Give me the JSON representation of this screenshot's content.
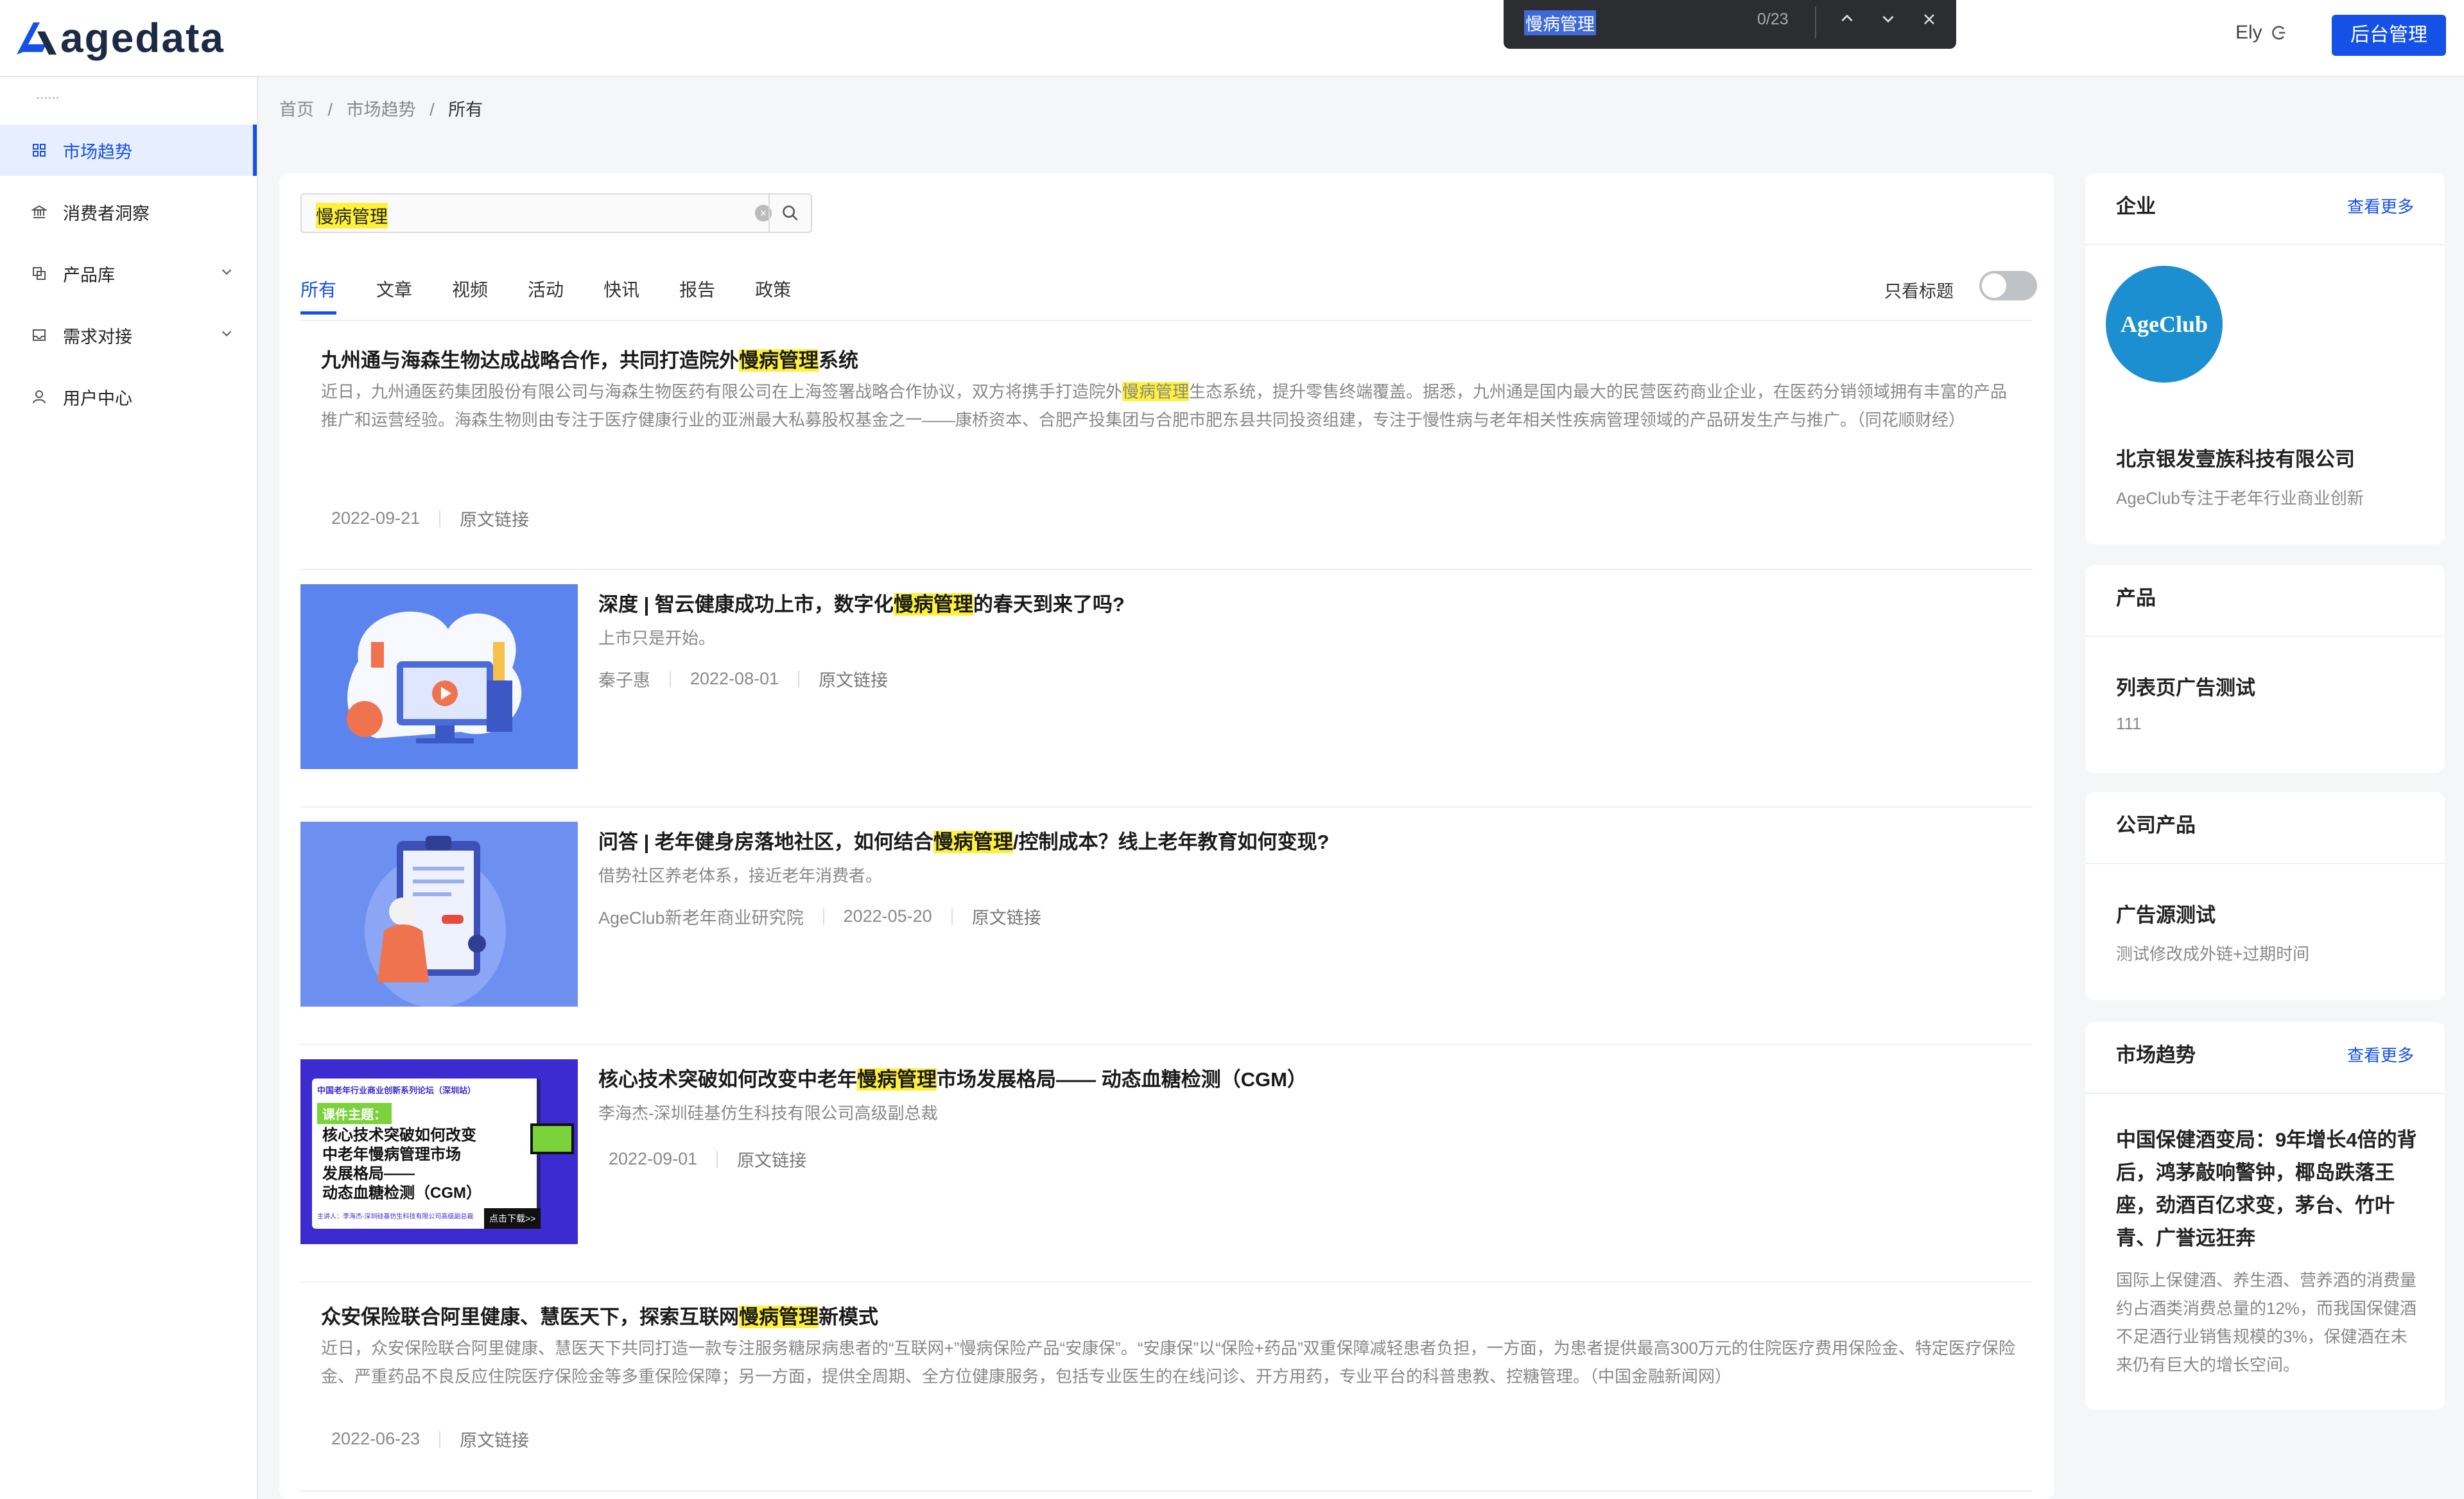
{
  "brand": {
    "logo_text": "agedata"
  },
  "find_bar": {
    "query": "慢病管理",
    "count": "0/23"
  },
  "header": {
    "user": "Ely",
    "admin_button": "后台管理"
  },
  "sidebar": {
    "dots": "......",
    "items": [
      {
        "label": "市场趋势",
        "icon": "grid-icon"
      },
      {
        "label": "消费者洞察",
        "icon": "bank-icon"
      },
      {
        "label": "产品库",
        "icon": "copy-icon"
      },
      {
        "label": "需求对接",
        "icon": "inbox-icon"
      },
      {
        "label": "用户中心",
        "icon": "user-icon"
      }
    ]
  },
  "breadcrumb": {
    "home": "首页",
    "sep": "/",
    "section": "市场趋势",
    "current": "所有"
  },
  "search": {
    "value": "慢病管理"
  },
  "tabs": [
    "所有",
    "文章",
    "视频",
    "活动",
    "快讯",
    "报告",
    "政策"
  ],
  "title_only_label": "只看标题",
  "articles": [
    {
      "title_pre": "九州通与海森生物达成战略合作，共同打造院外",
      "title_hl": "慢病管理",
      "title_post": "系统",
      "desc_pre": "近日，九州通医药集团股份有限公司与海森生物医药有限公司在上海签署战略合作协议，双方将携手打造院外",
      "desc_hl": "慢病管理",
      "desc_post": "生态系统，提升零售终端覆盖。据悉，九州通是国内最大的民营医药商业企业，在医药分销领域拥有丰富的产品推广和运营经验。海森生物则由专注于医疗健康行业的亚洲最大私募股权基金之一——康桥资本、合肥产投集团与合肥市肥东县共同投资组建，专注于慢性病与老年相关性疾病管理领域的产品研发生产与推广。（同花顺财经）",
      "date": "2022-09-21",
      "link": "原文链接"
    },
    {
      "title_pre": "深度 | 智云健康成功上市，数字化",
      "title_hl": "慢病管理",
      "title_post": "的春天到来了吗?",
      "desc": "上市只是开始。",
      "author": "秦子惠",
      "date": "2022-08-01",
      "link": "原文链接"
    },
    {
      "title_pre": "问答 | 老年健身房落地社区，如何结合",
      "title_hl": "慢病管理",
      "title_post": "/控制成本？线上老年教育如何变现?",
      "desc": "借势社区养老体系，接近老年消费者。",
      "author": "AgeClub新老年商业研究院",
      "date": "2022-05-20",
      "link": "原文链接"
    },
    {
      "title_pre": "核心技术突破如何改变中老年",
      "title_hl": "慢病管理",
      "title_post": "市场发展格局—— 动态血糖检测（CGM）",
      "desc": "李海杰-深圳硅基仿生科技有限公司高级副总裁",
      "date": "2022-09-01",
      "link": "原文链接",
      "thumb": {
        "top": "中国老年行业商业创新系列论坛（深圳站）",
        "tag": "课件主题：",
        "lines": [
          "核心技术突破如何改变",
          "中老年慢病管理市场",
          "发展格局——",
          "动态血糖检测（CGM）"
        ],
        "speaker": "主讲人：李海杰-深圳硅基仿生科技有限公司高级副总裁",
        "cta": "点击下载>>"
      }
    },
    {
      "title_pre": "众安保险联合阿里健康、慧医天下，探索互联网",
      "title_hl": "慢病管理",
      "title_post": "新模式",
      "desc": "近日，众安保险联合阿里健康、慧医天下共同打造一款专注服务糖尿病患者的“互联网+”慢病保险产品“安康保”。“安康保”以“保险+药品”双重保障减轻患者负担，一方面，为患者提供最高300万元的住院医疗费用保险金、特定医疗保险金、严重药品不良反应住院医疗保险金等多重保险保障；另一方面，提供全周期、全方位健康服务，包括专业医生的在线问诊、开方用药，专业平台的科普患教、控糖管理。（中国金融新闻网）",
      "date": "2022-06-23",
      "link": "原文链接"
    }
  ],
  "right": {
    "company": {
      "header": "企业",
      "more": "查看更多",
      "logo_text": "AgeClub",
      "name": "北京银发壹族科技有限公司",
      "desc": "AgeClub专注于老年行业商业创新"
    },
    "product": {
      "header": "产品",
      "name": "列表页广告测试",
      "desc": "111"
    },
    "company_product": {
      "header": "公司产品",
      "name": "广告源测试",
      "desc": "测试修改成外链+过期时间"
    },
    "trend": {
      "header": "市场趋势",
      "more": "查看更多",
      "title": "中国保健酒变局：9年增长4倍的背后，鸿茅敲响警钟，椰岛跌落王座，劲酒百亿求变，茅台、竹叶青、广誉远狂奔",
      "desc": "国际上保健酒、养生酒、营养酒的消费量约占酒类消费总量的12%，而我国保健酒不足酒行业销售规模的3%，保健酒在未来仍有巨大的增长空间。"
    }
  },
  "colors": {
    "accent": "#1551e6",
    "highlight": "#fff13a",
    "thumb_blue": "#5b84ee",
    "thumb_purple": "#3b2bd0"
  }
}
